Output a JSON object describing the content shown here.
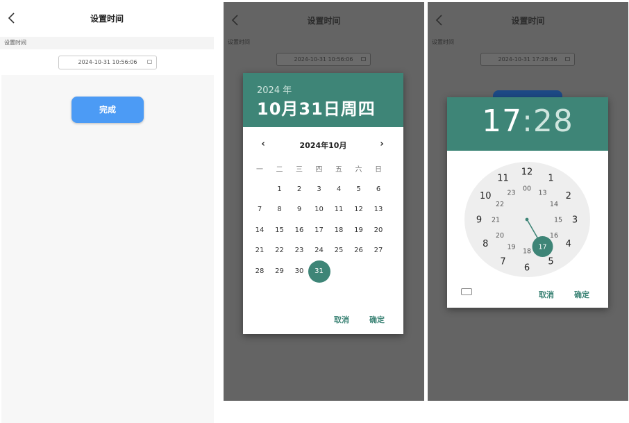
{
  "page": {
    "title": "设置时间"
  },
  "form": {
    "label": "设置时间",
    "value_initial": "2024-10-31 10:56:06",
    "value_final": "2024-10-31 17:28:36",
    "done_label": "完成"
  },
  "date_picker": {
    "year_label": "2024 年",
    "big_date": "10月31日周四",
    "month_title": "2024年10月",
    "prev_icon": "chevron-left-icon",
    "next_icon": "chevron-right-icon",
    "weekdays": [
      "一",
      "二",
      "三",
      "四",
      "五",
      "六",
      "日"
    ],
    "days": [
      [
        null,
        "1",
        "2",
        "3",
        "4",
        "5",
        "6"
      ],
      [
        "7",
        "8",
        "9",
        "10",
        "11",
        "12",
        "13"
      ],
      [
        "14",
        "15",
        "16",
        "17",
        "18",
        "19",
        "20"
      ],
      [
        "21",
        "22",
        "23",
        "24",
        "25",
        "26",
        "27"
      ],
      [
        "28",
        "29",
        "30",
        "31",
        null,
        null,
        null
      ]
    ],
    "selected_day": "31",
    "cancel": "取消",
    "ok": "确定",
    "accent": "#3e8577"
  },
  "time_picker": {
    "hour": "17",
    "sep": ":",
    "minute": "28",
    "outer_hours": [
      "12",
      "1",
      "2",
      "3",
      "4",
      "5",
      "6",
      "7",
      "8",
      "9",
      "10",
      "11"
    ],
    "inner_hours": [
      "00",
      "13",
      "14",
      "15",
      "16",
      "17",
      "18",
      "19",
      "20",
      "21",
      "22",
      "23"
    ],
    "selected_hour": "17",
    "cancel": "取消",
    "ok": "确定",
    "keyboard_icon": "keyboard-icon"
  }
}
